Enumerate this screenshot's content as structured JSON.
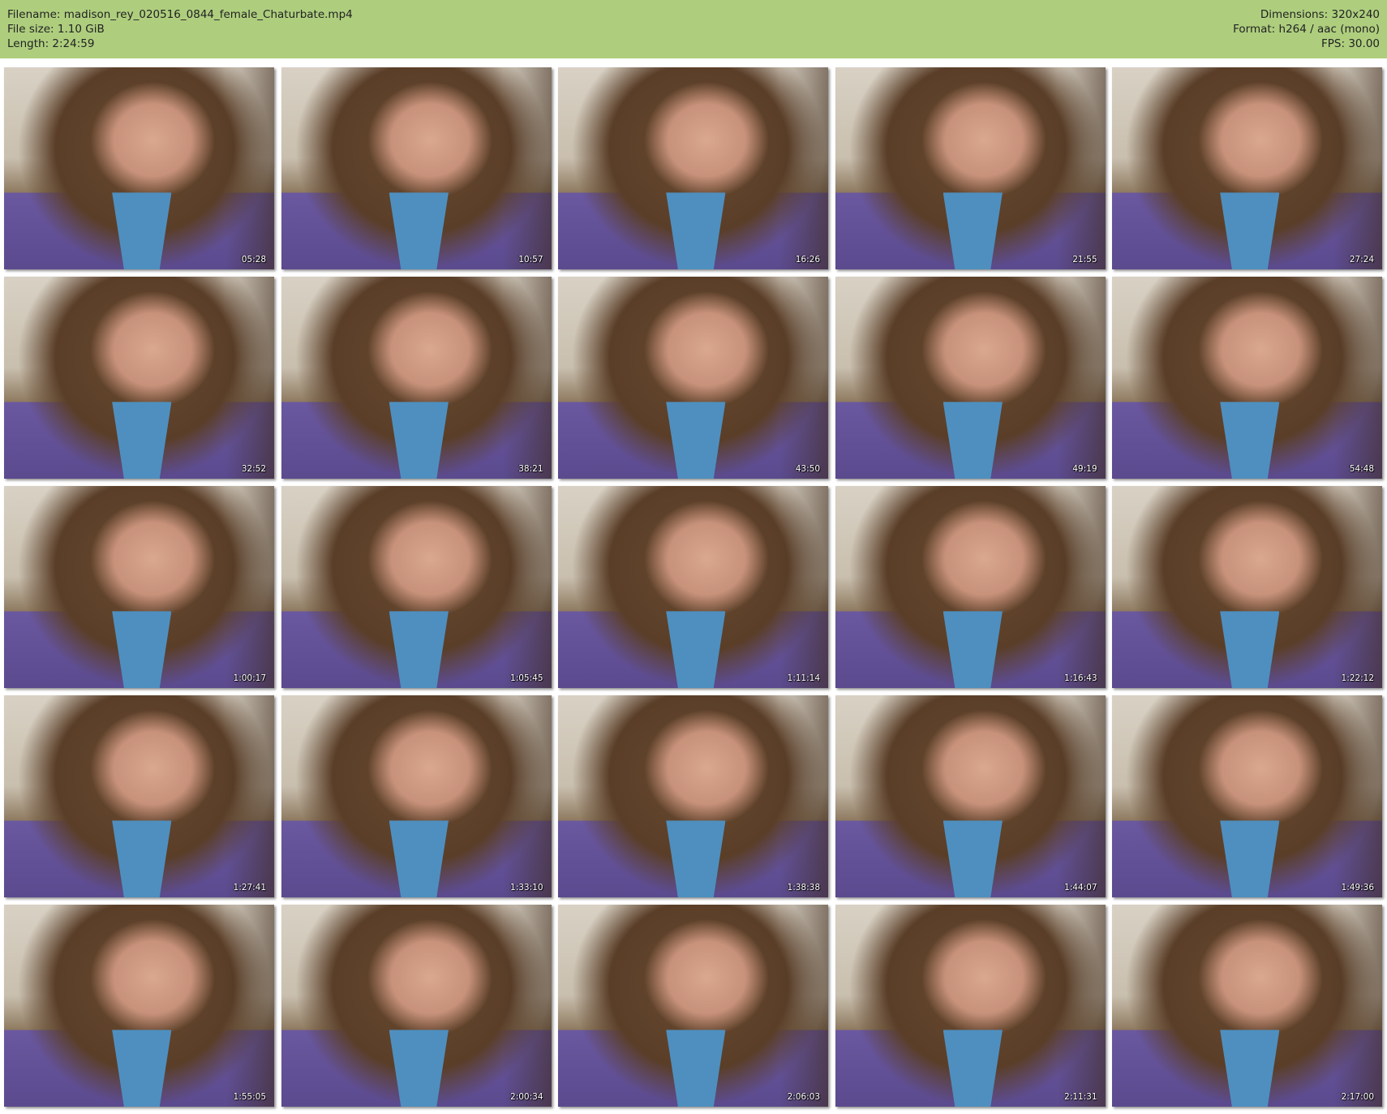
{
  "header": {
    "filename": "Filename: madison_rey_020516_0844_female_Chaturbate.mp4",
    "file_size": "File size: 1.10 GiB",
    "length": "Length: 2:24:59",
    "dimensions": "Dimensions: 320x240",
    "format": "Format: h264 / aac (mono)",
    "fps": "FPS: 30.00"
  },
  "thumbnails": [
    {
      "timestamp": "05:28"
    },
    {
      "timestamp": "10:57"
    },
    {
      "timestamp": "16:26"
    },
    {
      "timestamp": "21:55"
    },
    {
      "timestamp": "27:24"
    },
    {
      "timestamp": "32:52"
    },
    {
      "timestamp": "38:21"
    },
    {
      "timestamp": "43:50"
    },
    {
      "timestamp": "49:19"
    },
    {
      "timestamp": "54:48"
    },
    {
      "timestamp": "1:00:17"
    },
    {
      "timestamp": "1:05:45"
    },
    {
      "timestamp": "1:11:14"
    },
    {
      "timestamp": "1:16:43"
    },
    {
      "timestamp": "1:22:12"
    },
    {
      "timestamp": "1:27:41"
    },
    {
      "timestamp": "1:33:10"
    },
    {
      "timestamp": "1:38:38"
    },
    {
      "timestamp": "1:44:07"
    },
    {
      "timestamp": "1:49:36"
    },
    {
      "timestamp": "1:55:05"
    },
    {
      "timestamp": "2:00:34"
    },
    {
      "timestamp": "2:06:03"
    },
    {
      "timestamp": "2:11:31"
    },
    {
      "timestamp": "2:17:00"
    }
  ]
}
